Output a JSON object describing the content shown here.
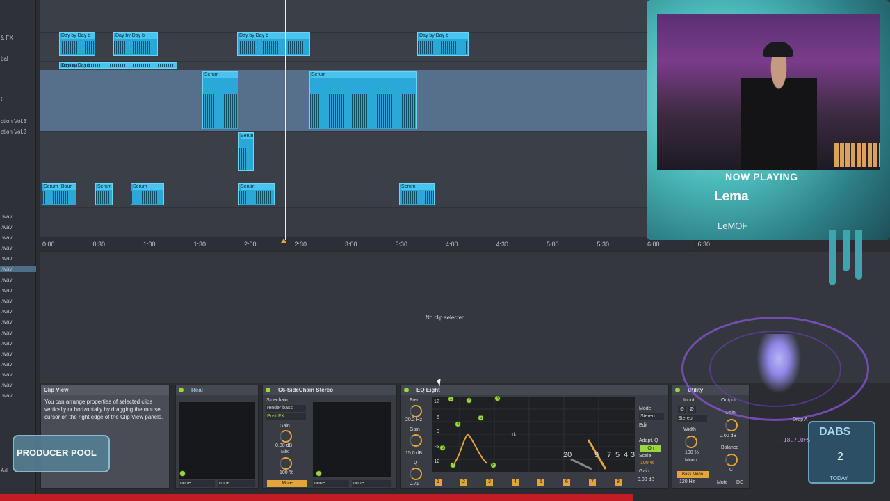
{
  "browser": {
    "items": [
      {
        "label": "& FX"
      },
      {
        "label": "bal"
      },
      {
        "label": "t"
      },
      {
        "label": "ction Vol.3"
      },
      {
        "label": "ction Vol.2"
      },
      {
        "label": ".wav"
      },
      {
        "label": ".wav"
      },
      {
        "label": ".wav"
      },
      {
        "label": ".wav"
      },
      {
        "label": ".wav"
      },
      {
        "label": ".wav"
      },
      {
        "label": ".wav"
      },
      {
        "label": ".wav"
      },
      {
        "label": ".wav"
      },
      {
        "label": ".wav"
      },
      {
        "label": ".wav"
      },
      {
        "label": ".wav"
      },
      {
        "label": ".wav"
      },
      {
        "label": ".wav"
      },
      {
        "label": ".wav"
      },
      {
        "label": ".wav"
      },
      {
        "label": ".wav"
      },
      {
        "label": ".wav"
      },
      {
        "label": "Ad"
      }
    ]
  },
  "arrangement": {
    "clip_names": {
      "day": "Day by Day b",
      "serum": "Serum",
      "serum_boun": "Serum (Boun"
    },
    "ruler": [
      "0:00",
      "0:30",
      "1:00",
      "1:30",
      "2:00",
      "2:30",
      "3:00",
      "3:30",
      "4:00",
      "4:30",
      "5:00",
      "5:30",
      "6:00",
      "6:30"
    ]
  },
  "detail": {
    "no_clip": "No clip selected."
  },
  "clip_view": {
    "title": "Clip View",
    "info": "You can arrange properties of selected clips vertically or horizontally by dragging the mouse cursor on the right edge of the Clip View panels."
  },
  "devices": {
    "real": {
      "title": "Real",
      "dd1": "none",
      "dd2": "none"
    },
    "sidechain": {
      "title": "C6-SideChain Stereo",
      "label_sidechain": "Sidechain",
      "source": "render bass",
      "postfx": "Post FX",
      "gain_label": "Gain",
      "gain_value": "0.00 dB",
      "mix_label": "Mix",
      "mix_value": "100 %",
      "mute": "Mute",
      "dd1": "none",
      "dd2": "none"
    },
    "eq": {
      "title": "EQ Eight",
      "freq_label": "Freq",
      "freq_value": "20.2 Hz",
      "gain_label": "Gain",
      "gain_value": "15.0 dB",
      "q_label": "Q",
      "q_value": "0.71",
      "y_labels": [
        "12",
        "6",
        "0",
        "-6",
        "-12"
      ],
      "mode_label": "Mode",
      "mode_value": "Stereo",
      "edit_label": "Edit",
      "adapt_label": "Adapt. Q",
      "adapt_value": "On",
      "scale_label": "Scale",
      "scale_value": "100 %",
      "gain_out_label": "Gain",
      "gain_out_value": "0.00 dB",
      "band_numbers": [
        "1",
        "2",
        "3",
        "4",
        "5",
        "6",
        "7",
        "8"
      ],
      "x_labels": [
        "20",
        "9",
        "7",
        "5",
        "4",
        "3"
      ],
      "mark_1k": "1k"
    },
    "utility": {
      "title": "Utility",
      "input_label": "Input",
      "output_label": "Output",
      "stereo_label": "Stereo",
      "width_label": "Width",
      "width_value": "100 %",
      "mono_label": "Mono",
      "bass_mono": "Bass Mono",
      "bass_freq": "120 Hz",
      "gain_label": "Gain",
      "gain_value": "0.00 dB",
      "balance_label": "Balance",
      "balance_value": "C",
      "mute": "Mute",
      "dc": "DC"
    }
  },
  "overlay": {
    "now_playing_label": "NOW PLAYING",
    "title": "Lema",
    "artist": "LeMOF",
    "producer_pool": "PRODUCER POOL",
    "dabs": "DABS",
    "dabs_sub": "TODAY",
    "dabs_count": "2",
    "lufs": "-18.7LUFS",
    "drop": "Drop A"
  },
  "colors": {
    "clip": "#2aa8d8",
    "accent_orange": "#e5a33b",
    "power_green": "#9ad63f",
    "status_red": "#c41c24",
    "viz_purple": "#8a55d8"
  }
}
